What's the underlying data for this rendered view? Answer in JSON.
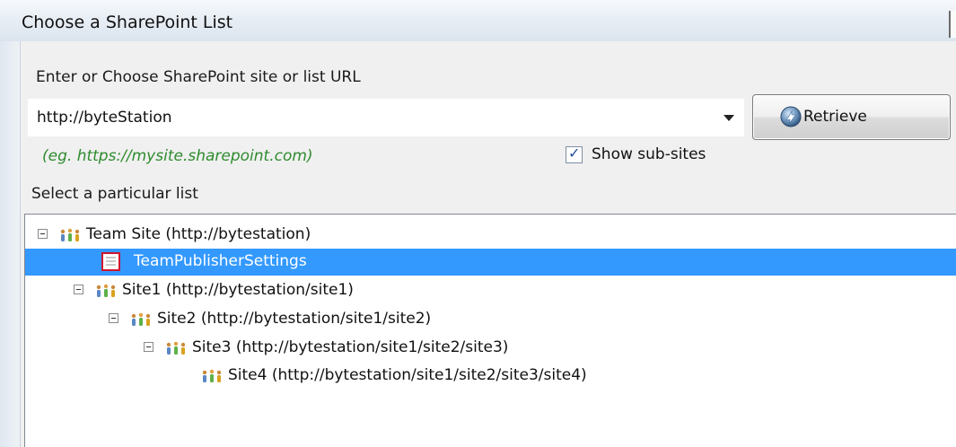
{
  "window": {
    "title": "Choose a SharePoint List"
  },
  "site": {
    "label": "Enter or Choose SharePoint site or list URL",
    "url_value": "http://byteStation",
    "retrieve_label": "Retrieve",
    "hint": "(eg. https://mysite.sharepoint.com)",
    "show_subsites_label": "Show sub-sites",
    "show_subsites_checked": true
  },
  "list_section": {
    "label": "Select a particular list"
  },
  "tree": {
    "nodes": [
      {
        "label": "Team Site (http://bytestation)",
        "type": "site",
        "expanded": true,
        "selected": false
      },
      {
        "label": "TeamPublisherSettings",
        "type": "list",
        "selected": true
      },
      {
        "label": "Site1 (http://bytestation/site1)",
        "type": "site",
        "expanded": true,
        "selected": false
      },
      {
        "label": "Site2 (http://bytestation/site1/site2)",
        "type": "site",
        "expanded": true,
        "selected": false
      },
      {
        "label": "Site3 (http://bytestation/site1/site2/site3)",
        "type": "site",
        "expanded": true,
        "selected": false
      },
      {
        "label": "Site4 (http://bytestation/site1/site2/site3/site4)",
        "type": "site",
        "expanded": false,
        "selected": false
      }
    ]
  },
  "colors": {
    "selection": "#3399ff",
    "hint": "#2e8b2e",
    "list_icon_border": "#d0142c"
  },
  "icons": {
    "site": "people-group-icon",
    "list": "list-icon",
    "retrieve": "retrieve-arrow-icon",
    "dropdown": "chevron-down-icon"
  }
}
